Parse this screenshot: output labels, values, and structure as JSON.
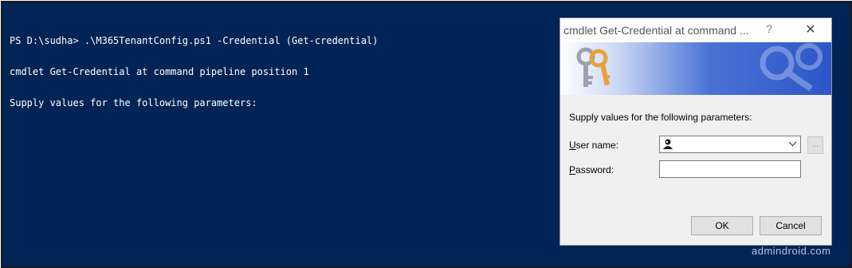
{
  "console": {
    "lines": [
      "PS D:\\sudha> .\\M365TenantConfig.ps1 -Credential (Get-credential)",
      "cmdlet Get-Credential at command pipeline position 1",
      "Supply values for the following parameters:"
    ]
  },
  "dialog": {
    "title": "cmdlet Get-Credential at command ...",
    "help_symbol": "?",
    "close_symbol": "✕",
    "prompt": "Supply values for the following parameters:",
    "username_label_accel": "U",
    "username_label_rest": "ser name:",
    "username_value": "",
    "browse_label": "...",
    "password_label_accel": "P",
    "password_label_rest": "assword:",
    "password_value": "",
    "ok_label": "OK",
    "cancel_label": "Cancel"
  },
  "watermark": "admindroid.com",
  "colors": {
    "console_bg": "#012456",
    "console_text": "#ffffff",
    "banner_blue": "#2c56c8"
  }
}
